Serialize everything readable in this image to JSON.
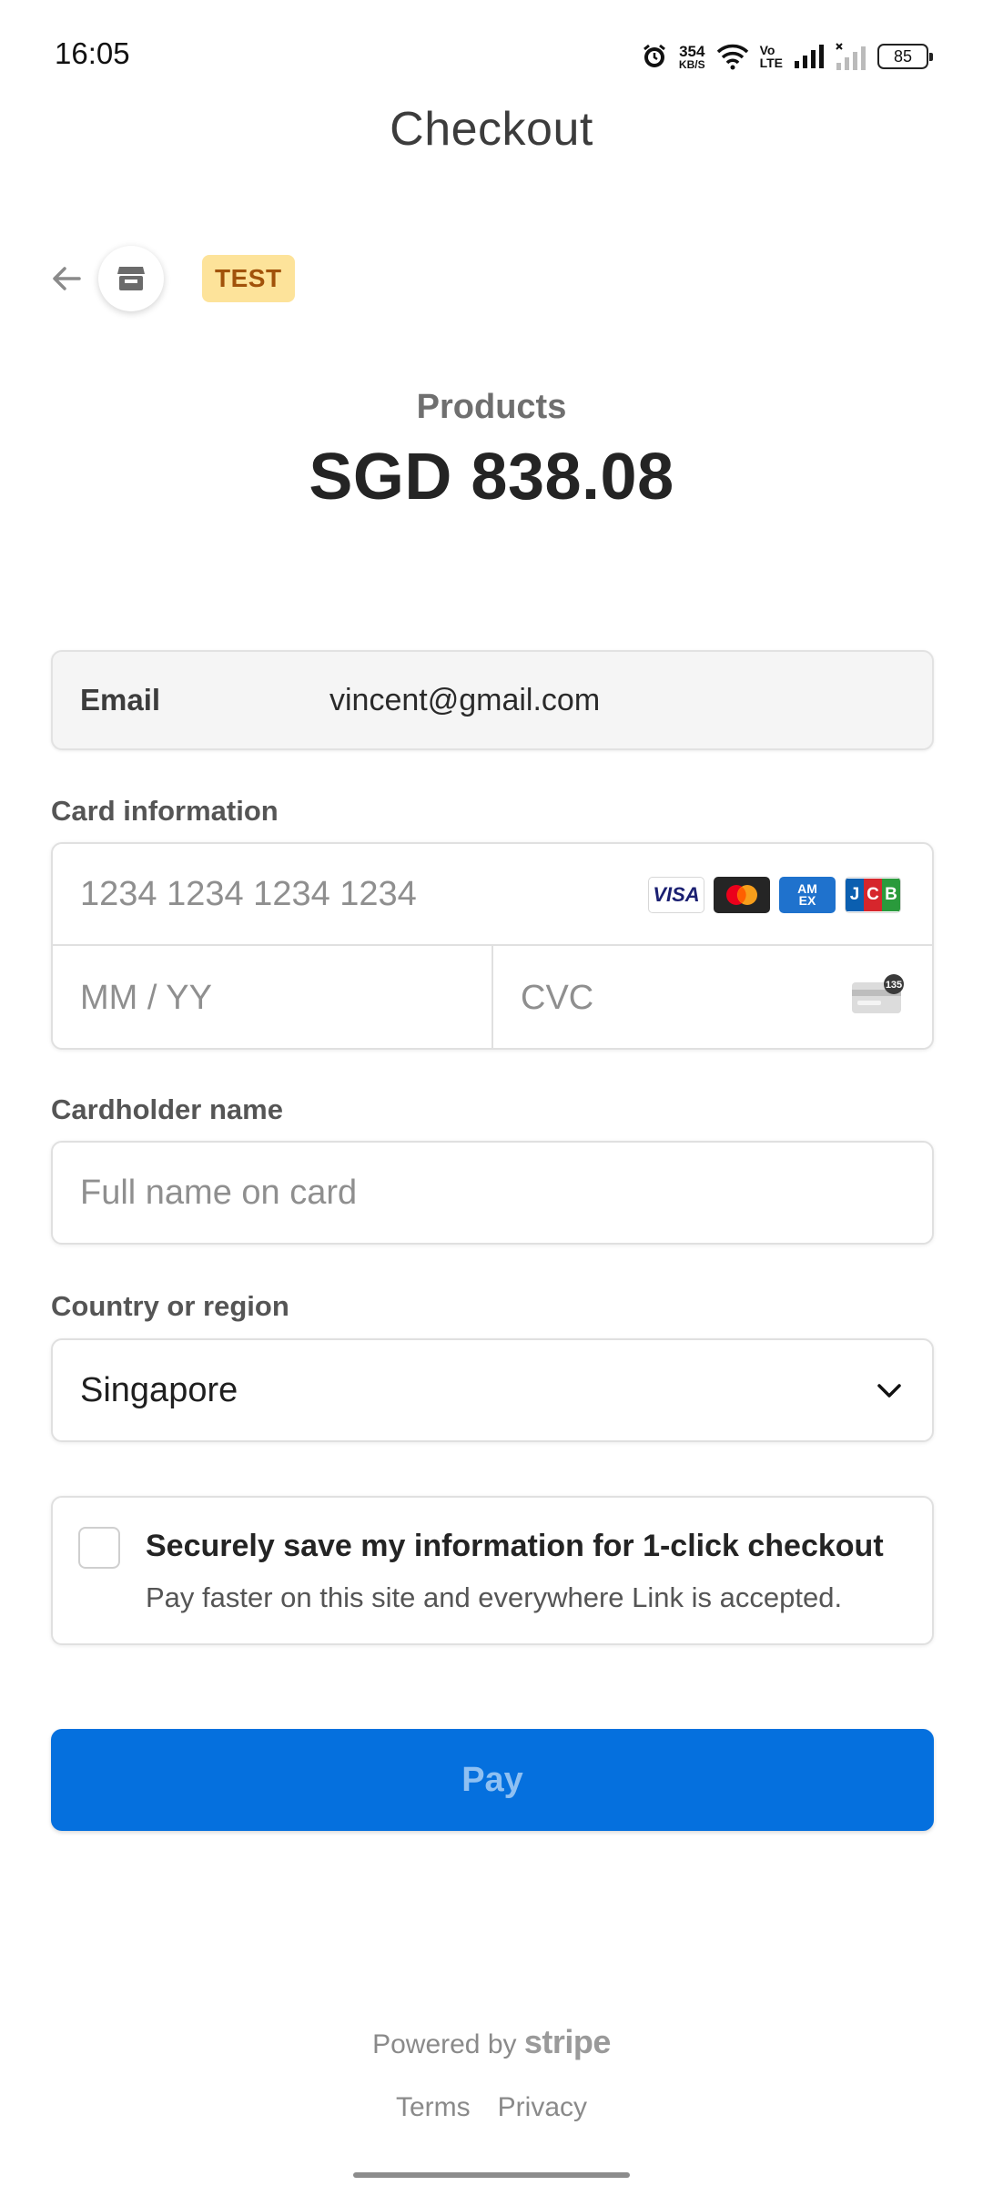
{
  "status_bar": {
    "time": "16:05",
    "net_speed_value": "354",
    "net_speed_unit": "KB/S",
    "volte_top": "Vo",
    "volte_bottom": "LTE",
    "battery_level": "85",
    "icons": [
      "alarm-icon",
      "wifi-icon",
      "volte-icon",
      "signal-icon",
      "signal-no-service-icon",
      "battery-icon"
    ]
  },
  "header": {
    "title": "Checkout",
    "badge": "TEST",
    "back_icon": "arrow-left-icon",
    "store_icon": "store-icon"
  },
  "summary": {
    "label": "Products",
    "amount": "SGD 838.08"
  },
  "form": {
    "email_label": "Email",
    "email_value": "vincent@gmail.com",
    "card_label": "Card information",
    "card_number_placeholder": "1234 1234 1234 1234",
    "expiry_placeholder": "MM / YY",
    "cvc_placeholder": "CVC",
    "cvc_icon_badge": "135",
    "card_brands": {
      "visa": "VISA",
      "mastercard": "mastercard",
      "amex_line1": "AM",
      "amex_line2": "EX",
      "jcb_1": "J",
      "jcb_2": "C",
      "jcb_3": "B"
    },
    "cardholder_label": "Cardholder name",
    "cardholder_placeholder": "Full name on card",
    "country_label": "Country or region",
    "country_value": "Singapore",
    "save_title": "Securely save my information for 1-click checkout",
    "save_subtitle": "Pay faster on this site and everywhere Link is accepted.",
    "save_checked": false
  },
  "pay_button": "Pay",
  "footer": {
    "powered_by": "Powered by",
    "powered_brand": "stripe",
    "terms": "Terms",
    "privacy": "Privacy"
  },
  "colors": {
    "pay_button": "#0570de",
    "badge_bg": "#fde39a",
    "badge_text": "#a1520a"
  }
}
